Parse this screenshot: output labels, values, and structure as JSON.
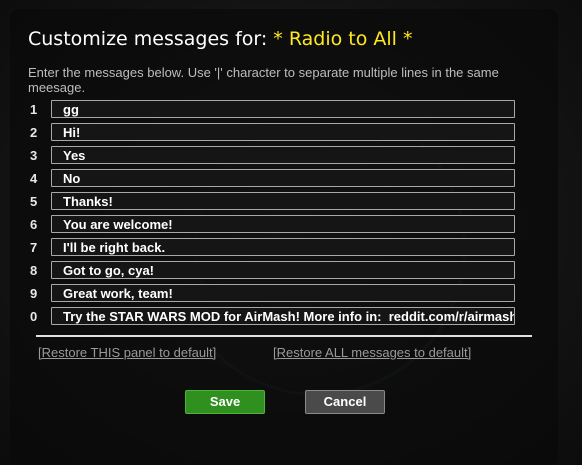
{
  "dialog": {
    "title": "Customize messages for:",
    "channel": "* Radio to All *",
    "instructions": "Enter the messages below. Use '|' character to separate multiple lines in the same meesage."
  },
  "messages": [
    {
      "number": "1",
      "value": "gg"
    },
    {
      "number": "2",
      "value": "Hi!"
    },
    {
      "number": "3",
      "value": "Yes"
    },
    {
      "number": "4",
      "value": "No"
    },
    {
      "number": "5",
      "value": "Thanks!"
    },
    {
      "number": "6",
      "value": "You are welcome!"
    },
    {
      "number": "7",
      "value": "I'll be right back."
    },
    {
      "number": "8",
      "value": "Got to go, cya!"
    },
    {
      "number": "9",
      "value": "Great work, team!"
    },
    {
      "number": "0",
      "value": "Try the STAR WARS MOD for AirMash! More info in:  reddit.com/r/airmash"
    }
  ],
  "links": {
    "restore_this": "[Restore THIS panel to default]",
    "restore_all": "[Restore ALL messages to default]"
  },
  "buttons": {
    "save": "Save",
    "cancel": "Cancel"
  },
  "colors": {
    "highlight": "#ffe81f",
    "save_button": "#2f8f1f",
    "cancel_button": "#4a4a4a"
  }
}
